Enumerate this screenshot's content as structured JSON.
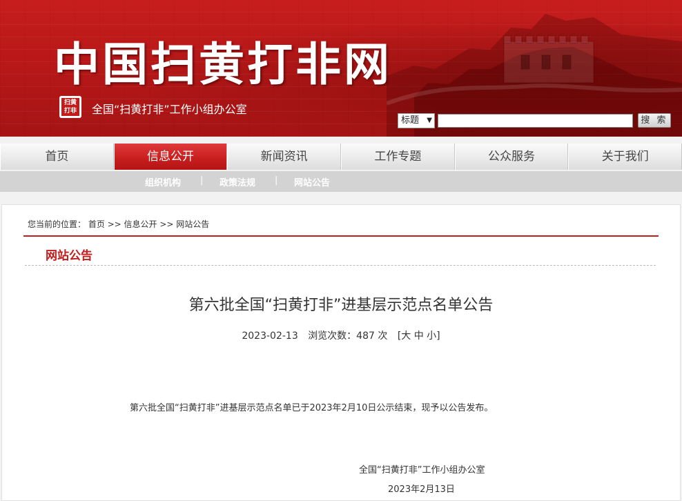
{
  "header": {
    "site_title": "中国扫黄打非网",
    "seal_text": "扫黄打非",
    "subtitle": "全国“扫黄打非”工作小组办公室",
    "search_type": "标题",
    "search_button": "搜 索"
  },
  "nav": {
    "items": [
      "首页",
      "信息公开",
      "新闻资讯",
      "工作专题",
      "公众服务",
      "关于我们"
    ],
    "active_index": 1
  },
  "subnav": {
    "items": [
      "组织机构",
      "政策法规",
      "网站公告"
    ],
    "separator": "|"
  },
  "breadcrumb": {
    "text": "您当前的位置： 首页 >> 信息公开 >> 网站公告"
  },
  "section": {
    "title": "网站公告"
  },
  "article": {
    "title": "第六批全国“扫黄打非”进基层示范点名单公告",
    "date": "2023-02-13",
    "views_label": "浏览次数：487 次",
    "font_size_control": "[大 中 小]",
    "body": "第六批全国“扫黄打非”进基层示范点名单已于2023年2月10日公示结束，现予以公告发布。",
    "signature_org": "全国“扫黄打非”工作小组办公室",
    "signature_date": "2023年2月13日"
  },
  "colors": {
    "brand_red": "#c41b1b",
    "nav_bg": "#e9e9e9",
    "subnav_bg": "#d3d3d3"
  }
}
